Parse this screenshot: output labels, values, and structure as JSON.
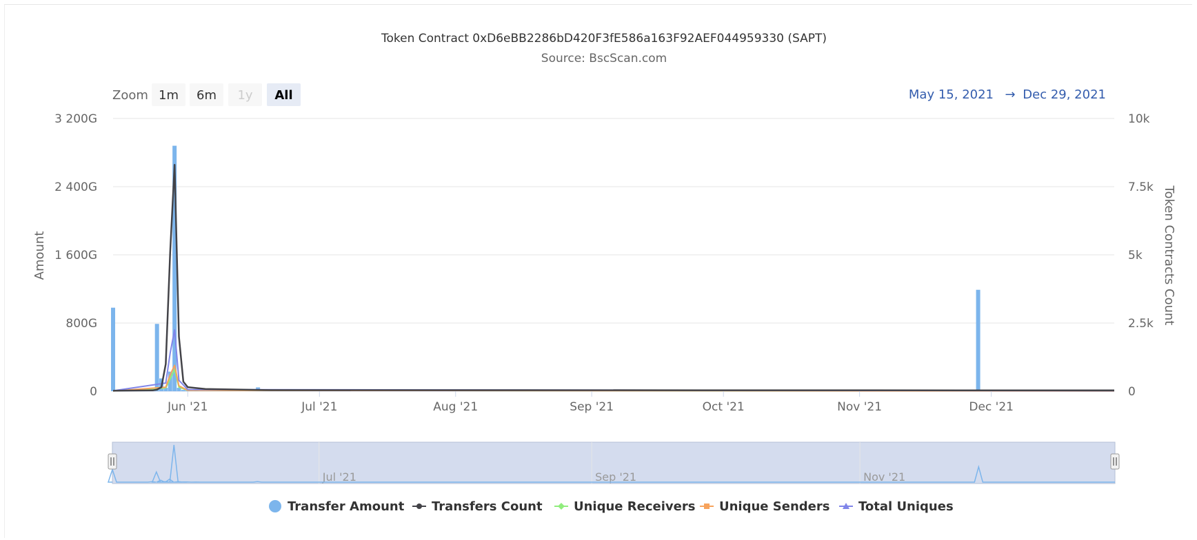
{
  "header": {
    "title": "Token Contract 0xD6eBB2286bD420F3fE586a163F92AEF044959330 (SAPT)",
    "subtitle": "Source: BscScan.com"
  },
  "zoom": {
    "label": "Zoom",
    "buttons": [
      {
        "label": "1m",
        "state": "enabled"
      },
      {
        "label": "6m",
        "state": "enabled"
      },
      {
        "label": "1y",
        "state": "disabled"
      },
      {
        "label": "All",
        "state": "selected"
      }
    ]
  },
  "range": {
    "from": "May 15, 2021",
    "arrow": "→",
    "to": "Dec 29, 2021"
  },
  "colors": {
    "transfer_amount": "#7cb5ec",
    "transfers_count": "#434348",
    "unique_receivers": "#90ed7d",
    "unique_senders": "#f7a35c",
    "total_uniques": "#8085e9",
    "navigator_mask": "#ccd6eb",
    "range_text": "#335cad"
  },
  "chart_data": {
    "type": "bar",
    "x_axis": {
      "type": "datetime",
      "range": [
        "2021-05-15",
        "2021-12-29"
      ],
      "tick_labels": [
        "Jun '21",
        "Jul '21",
        "Aug '21",
        "Sep '21",
        "Oct '21",
        "Nov '21",
        "Dec '21"
      ],
      "tick_dates": [
        "2021-06-01",
        "2021-07-01",
        "2021-08-01",
        "2021-09-01",
        "2021-10-01",
        "2021-11-01",
        "2021-12-01"
      ]
    },
    "y_axis_left": {
      "label": "Amount",
      "range": [
        0,
        3200
      ],
      "unit": "G",
      "tick_labels": [
        "0",
        "800G",
        "1 600G",
        "2 400G",
        "3 200G"
      ],
      "tick_values": [
        0,
        800,
        1600,
        2400,
        3200
      ]
    },
    "y_axis_right": {
      "label": "Token Contracts Count",
      "range": [
        0,
        10000
      ],
      "tick_labels": [
        "0",
        "2.5k",
        "5k",
        "7.5k",
        "10k"
      ],
      "tick_values": [
        0,
        2500,
        5000,
        7500,
        10000
      ]
    },
    "grid": true,
    "legend_position": "bottom-center",
    "series": [
      {
        "name": "Transfer Amount",
        "type": "bar",
        "axis": "left",
        "data": [
          {
            "date": "2021-05-15",
            "value": 980
          },
          {
            "date": "2021-05-24",
            "value": 30
          },
          {
            "date": "2021-05-25",
            "value": 790
          },
          {
            "date": "2021-05-26",
            "value": 150
          },
          {
            "date": "2021-05-27",
            "value": 40
          },
          {
            "date": "2021-05-28",
            "value": 230
          },
          {
            "date": "2021-05-29",
            "value": 2880
          },
          {
            "date": "2021-05-30",
            "value": 40
          },
          {
            "date": "2021-05-31",
            "value": 15
          },
          {
            "date": "2021-06-01",
            "value": 10
          },
          {
            "date": "2021-06-03",
            "value": 8
          },
          {
            "date": "2021-06-17",
            "value": 45
          },
          {
            "date": "2021-11-28",
            "value": 1190
          }
        ]
      },
      {
        "name": "Transfers Count",
        "type": "line",
        "axis": "right",
        "data": [
          {
            "date": "2021-05-15",
            "value": 20
          },
          {
            "date": "2021-05-24",
            "value": 30
          },
          {
            "date": "2021-05-25",
            "value": 60
          },
          {
            "date": "2021-05-26",
            "value": 150
          },
          {
            "date": "2021-05-27",
            "value": 1000
          },
          {
            "date": "2021-05-28",
            "value": 5100
          },
          {
            "date": "2021-05-29",
            "value": 8300
          },
          {
            "date": "2021-05-30",
            "value": 2000
          },
          {
            "date": "2021-05-31",
            "value": 350
          },
          {
            "date": "2021-06-01",
            "value": 150
          },
          {
            "date": "2021-06-05",
            "value": 80
          },
          {
            "date": "2021-06-20",
            "value": 40
          },
          {
            "date": "2021-12-29",
            "value": 30
          }
        ]
      },
      {
        "name": "Unique Receivers",
        "type": "line",
        "axis": "right",
        "data": [
          {
            "date": "2021-05-15",
            "value": 10
          },
          {
            "date": "2021-05-27",
            "value": 120
          },
          {
            "date": "2021-05-28",
            "value": 450
          },
          {
            "date": "2021-05-29",
            "value": 800
          },
          {
            "date": "2021-05-30",
            "value": 150
          },
          {
            "date": "2021-06-01",
            "value": 30
          },
          {
            "date": "2021-12-29",
            "value": 10
          }
        ]
      },
      {
        "name": "Unique Senders",
        "type": "line",
        "axis": "right",
        "data": [
          {
            "date": "2021-05-15",
            "value": 8
          },
          {
            "date": "2021-05-27",
            "value": 150
          },
          {
            "date": "2021-05-28",
            "value": 600
          },
          {
            "date": "2021-05-29",
            "value": 950
          },
          {
            "date": "2021-05-30",
            "value": 200
          },
          {
            "date": "2021-06-01",
            "value": 30
          },
          {
            "date": "2021-12-29",
            "value": 8
          }
        ]
      },
      {
        "name": "Total Uniques",
        "type": "line",
        "axis": "right",
        "data": [
          {
            "date": "2021-05-15",
            "value": 15
          },
          {
            "date": "2021-05-27",
            "value": 300
          },
          {
            "date": "2021-05-28",
            "value": 1400
          },
          {
            "date": "2021-05-29",
            "value": 2250
          },
          {
            "date": "2021-05-30",
            "value": 400
          },
          {
            "date": "2021-06-01",
            "value": 60
          },
          {
            "date": "2021-12-29",
            "value": 15
          }
        ]
      }
    ]
  },
  "navigator": {
    "tick_labels": [
      "Jul '21",
      "Sep '21",
      "Nov '21"
    ],
    "tick_dates": [
      "2021-07-01",
      "2021-09-01",
      "2021-11-01"
    ],
    "selected_range": [
      "2021-05-15",
      "2021-12-29"
    ]
  }
}
